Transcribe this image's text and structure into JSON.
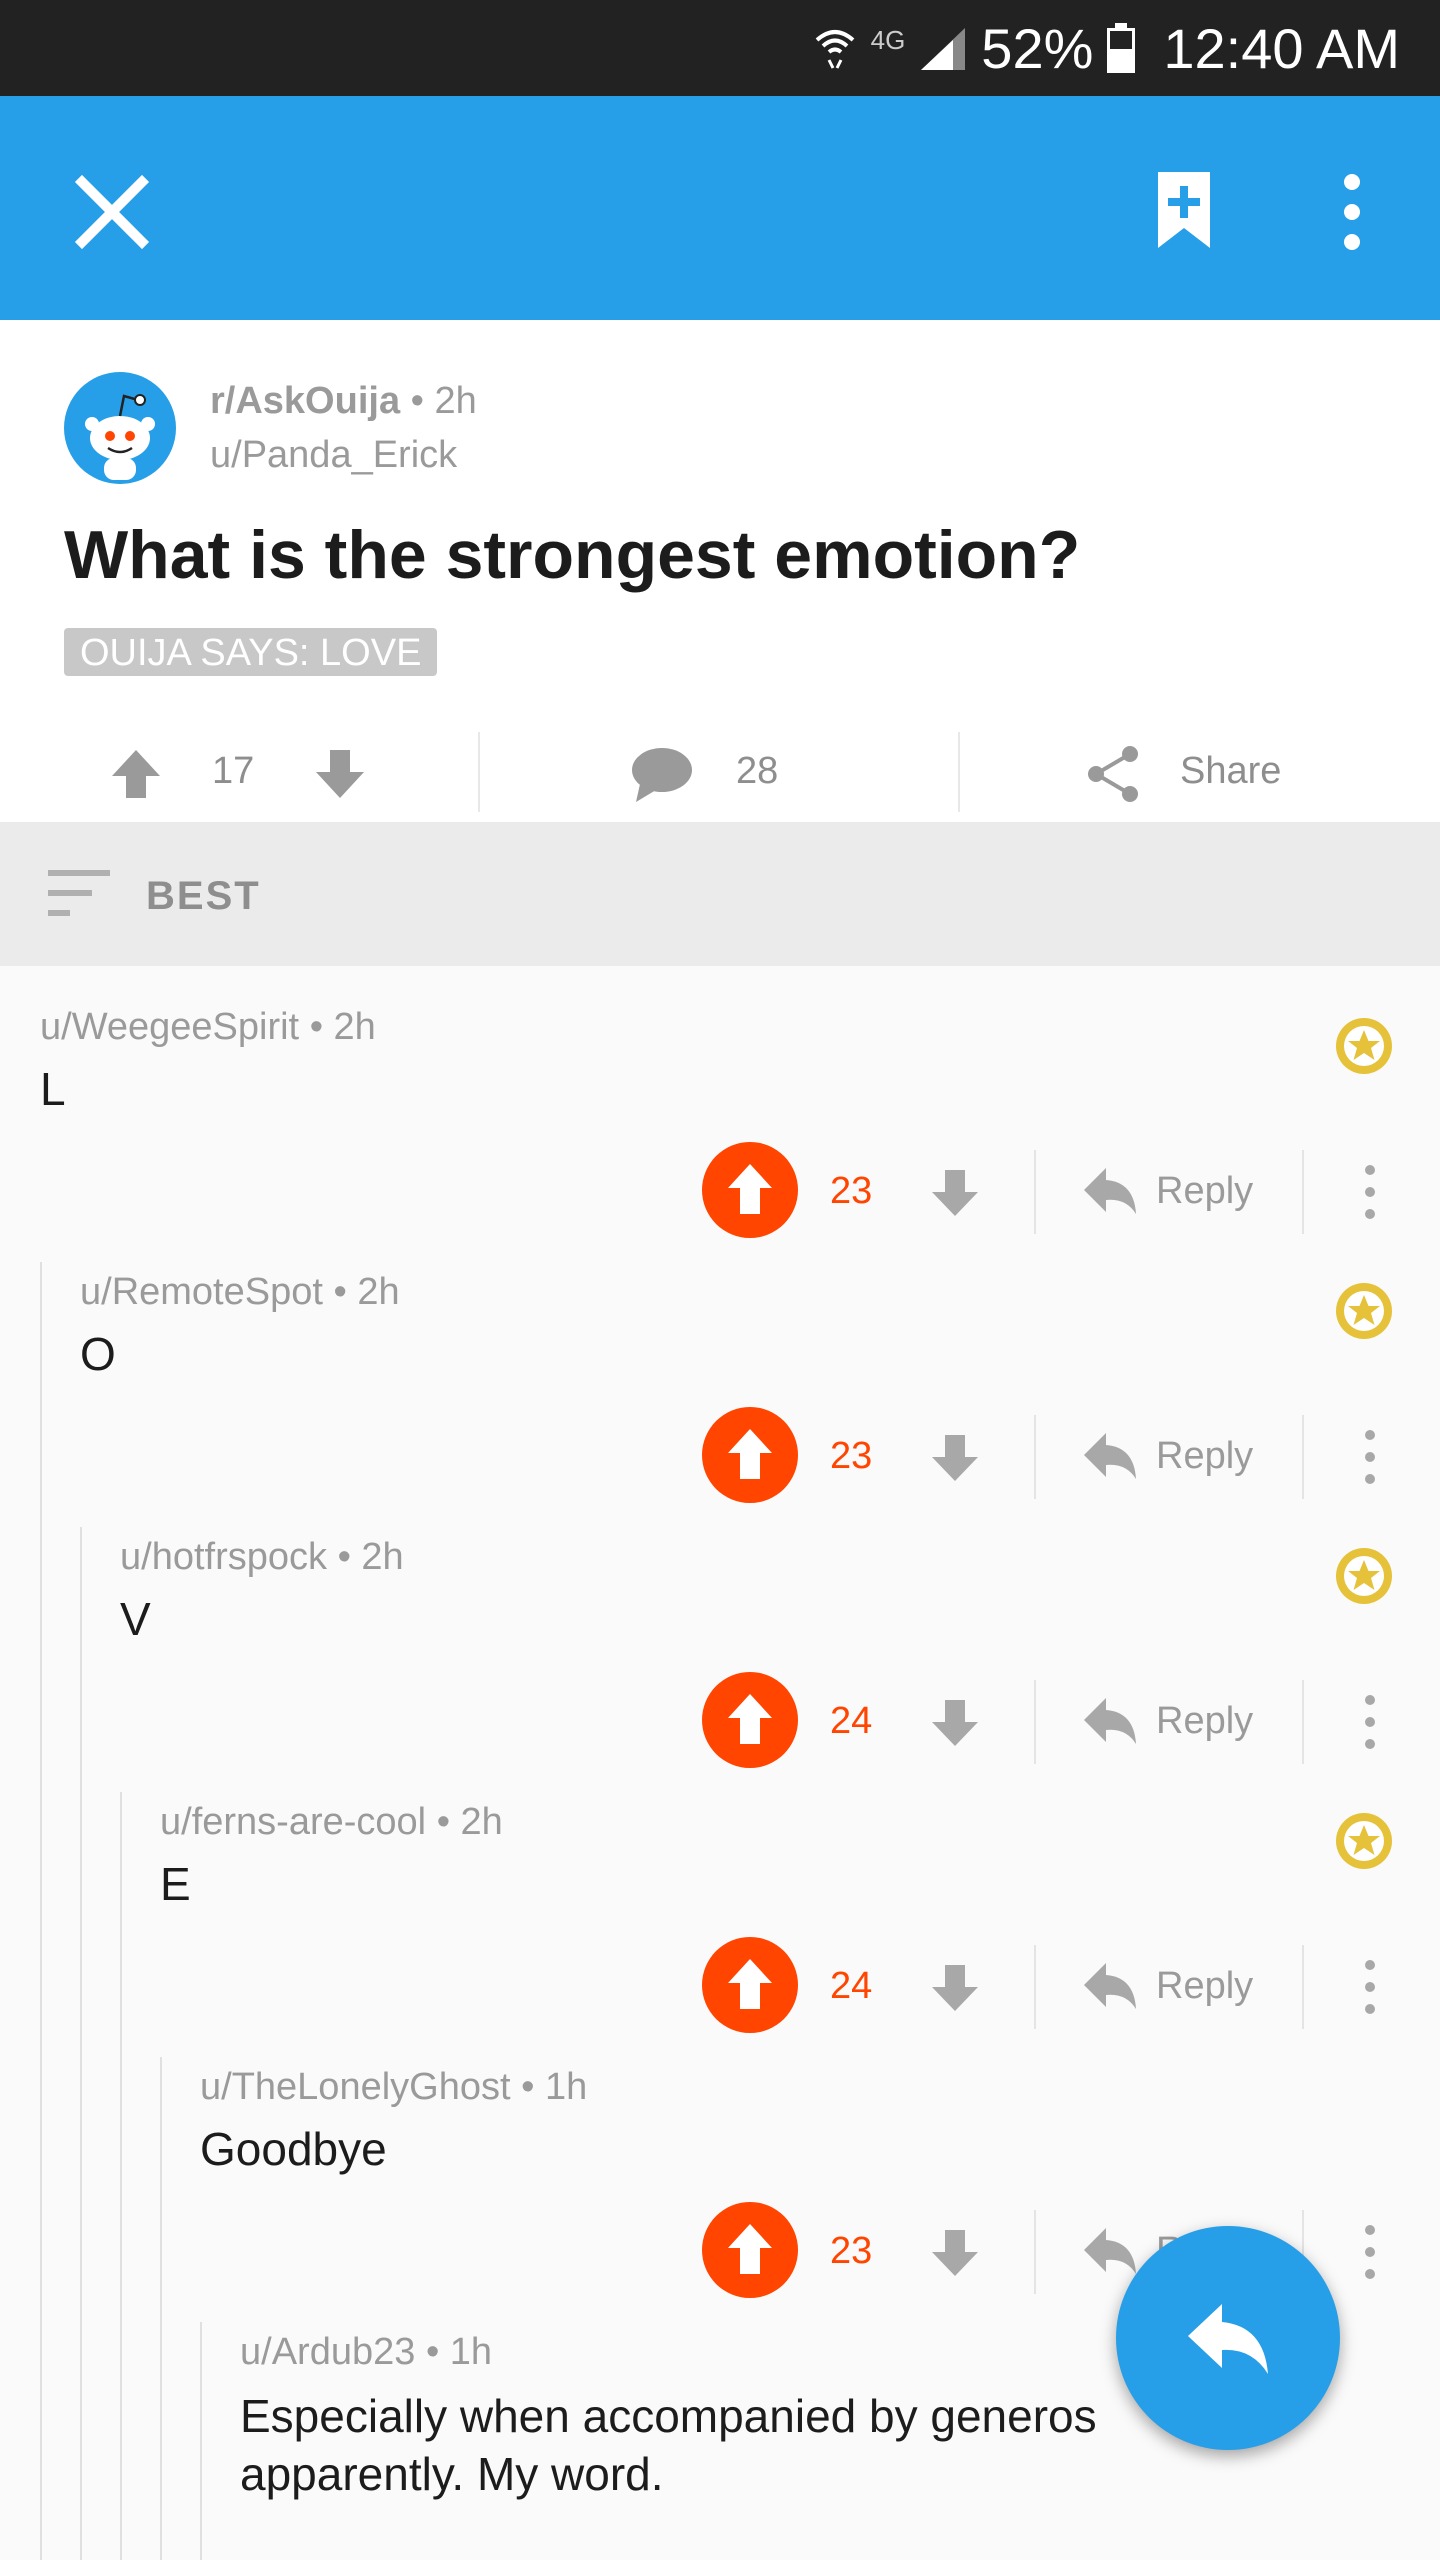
{
  "status_bar": {
    "network": "4G",
    "battery": "52%",
    "time": "12:40 AM"
  },
  "app_bar": {
    "close_icon": "close-icon",
    "bookmark_icon": "bookmark-add-icon",
    "more_icon": "more-vertical-icon",
    "color": "#279ee8"
  },
  "post": {
    "subreddit": "r/AskOuija",
    "age": "• 2h",
    "author": "u/Panda_Erick",
    "title": "What is the strongest emotion?",
    "flair": "OUIJA SAYS: LOVE",
    "score": "17",
    "comments": "28",
    "share_label": "Share"
  },
  "sort": {
    "label": "BEST"
  },
  "comments": [
    {
      "author": "u/WeegeeSpirit",
      "age": "• 2h",
      "body": "L",
      "score": "23",
      "reply": "Reply"
    },
    {
      "author": "u/RemoteSpot",
      "age": "• 2h",
      "body": "O",
      "score": "23",
      "reply": "Reply"
    },
    {
      "author": "u/hotfrspock",
      "age": "• 2h",
      "body": "V",
      "score": "24",
      "reply": "Reply"
    },
    {
      "author": "u/ferns-are-cool",
      "age": "• 2h",
      "body": "E",
      "score": "24",
      "reply": "Reply"
    },
    {
      "author": "u/TheLonelyGhost",
      "age": "• 1h",
      "body": "Goodbye",
      "score": "23",
      "reply": "Reply"
    },
    {
      "author": "u/Ardub23",
      "age": "• 1h",
      "body_line1": "Especially when accompanied by generos",
      "body_line2": "apparently. My word."
    }
  ],
  "colors": {
    "accent": "#279ee8",
    "upvote": "#ff4500",
    "award": "#e5c23a"
  }
}
